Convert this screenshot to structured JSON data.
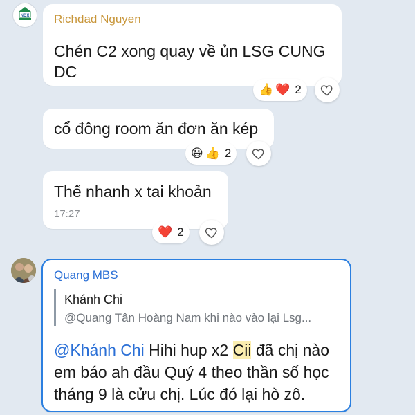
{
  "colors": {
    "background": "#e2e9f1",
    "sender_gold": "#c8963a",
    "sender_blue": "#2a6fd6",
    "mention_blue": "#2a6fd6",
    "highlight": "#fbeeb0",
    "selected_border": "#2b7fe0"
  },
  "messages": [
    {
      "sender": "Richdad Nguyen",
      "avatar_text": "NDX",
      "text_line1": "Chén C2 xong quay về ủn LSG CUNG",
      "text_line2": "DC",
      "reactions": {
        "icons": [
          "thumbs-up-icon",
          "heart-icon"
        ],
        "count": "2"
      }
    },
    {
      "text": "cổ đông room ăn đơn ăn kép",
      "reactions": {
        "icons": [
          "laughing-face-icon",
          "thumbs-up-icon"
        ],
        "count": "2"
      }
    },
    {
      "text": "Thế nhanh x tai khoản",
      "time": "17:27",
      "reactions": {
        "icons": [
          "heart-icon"
        ],
        "count": "2"
      }
    }
  ],
  "reply": {
    "sender": "Quang MBS",
    "quote_author": "Khánh Chi",
    "quote_text": "@Quang Tân Hoàng Nam khi nào vào lại Lsg...",
    "mention": "@Khánh Chi",
    "text_a": " Hihi hup x2 ",
    "text_highlight": "Cii",
    "text_b": " đã chị nào",
    "text_line2": "em báo ah đầu Quý 4 theo thần số học",
    "text_line3": "tháng 9 là cửu chị. Lúc đó lại hò zô."
  }
}
